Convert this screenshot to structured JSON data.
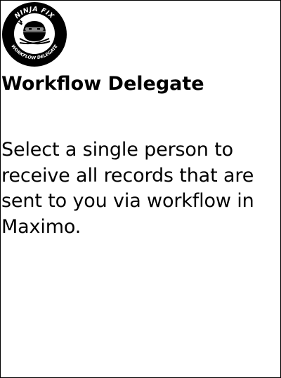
{
  "logo": {
    "text_top": "NINJA FIX",
    "text_bottom": "WORKFLOW DELEGATE",
    "icon": "ninja-icon"
  },
  "title": "Workflow Delegate",
  "description": "Select a single person to receive all records that are sent to you via workflow in Maximo.",
  "colors": {
    "background": "#ffffff",
    "text": "#000000",
    "border": "#000000",
    "logo_ring": "#000000"
  }
}
